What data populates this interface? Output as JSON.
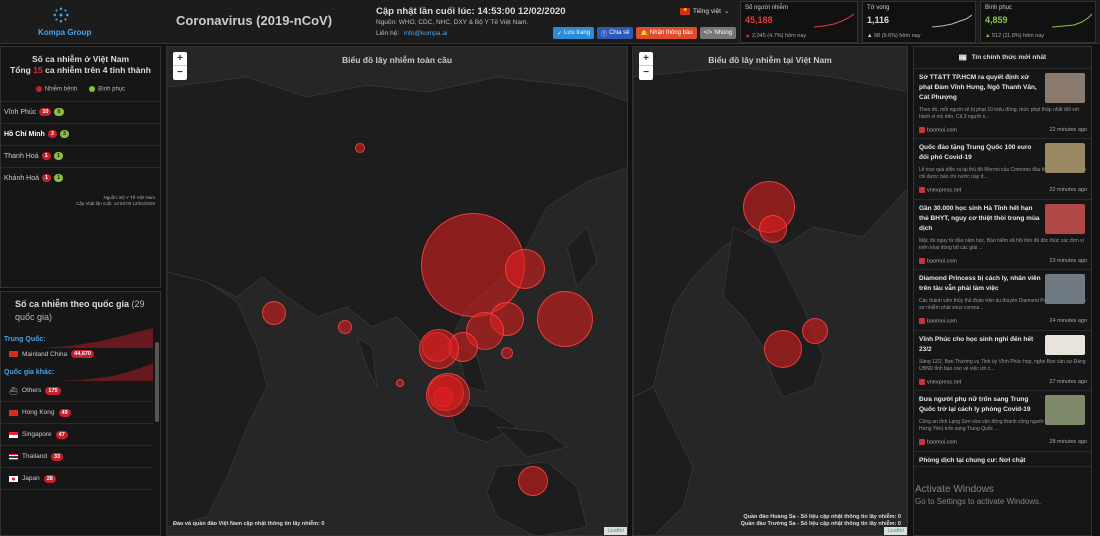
{
  "header": {
    "logo_text": "Kompa Group",
    "title": "Coronavirus (2019-nCoV)",
    "updated": "Cập nhật lần cuối lúc: 14:53:00 12/02/2020",
    "sources": "Nguồn: WHO, CDC, NHC, DXY & Bộ Y Tế Việt Nam.",
    "contact_label": "Liên hệ:",
    "contact_email": "info@kompa.ai",
    "language": "Tiếng việt",
    "buttons": {
      "save": "Lưu trang",
      "share": "Chia sẻ",
      "notify": "Nhận thông báo",
      "embed": "Nhúng"
    }
  },
  "stats": [
    {
      "label": "Số người nhiễm",
      "value": "45,188",
      "sub": "2,045 (4.7%) hôm nay",
      "color": "#e23b3b",
      "arrow": "▲"
    },
    {
      "label": "Tử vong",
      "value": "1,116",
      "sub": "98 (9.6%) hôm nay",
      "color": "#dddddd",
      "arrow": "▲"
    },
    {
      "label": "Bình phục",
      "value": "4,859",
      "sub": "512 (11.8%) hôm nay",
      "color": "#8bc34a",
      "arrow": "▲"
    }
  ],
  "vietnam": {
    "title_line1": "Số ca nhiễm ở Việt Nam",
    "total_prefix": "Tổng",
    "total": "15",
    "total_suffix": "ca nhiễm trên 4 tỉnh thành",
    "legend_infected": "Nhiễm bệnh",
    "legend_recovered": "Bình phục",
    "provinces": [
      {
        "name": "Vĩnh Phúc",
        "infected": "10",
        "recovered": "6",
        "bold": false
      },
      {
        "name": "Hồ Chí Minh",
        "infected": "3",
        "recovered": "3",
        "bold": true
      },
      {
        "name": "Thanh Hoá",
        "infected": "1",
        "recovered": "1",
        "bold": false
      },
      {
        "name": "Khánh Hoà",
        "infected": "1",
        "recovered": "1",
        "bold": false
      }
    ],
    "source_line1": "Nguồn: Bộ Y Tế Việt Nam",
    "source_line2": "Cập nhật lần cuối: 14:53:00 12/02/2020"
  },
  "countries": {
    "title": "Số ca nhiễm theo quốc gia",
    "count": "(29",
    "title_line2": "quốc gia)",
    "china_label": "Trung Quốc:",
    "china": {
      "name": "Mainland China",
      "value": "44,670"
    },
    "other_label": "Quốc gia khác:",
    "list": [
      {
        "name": "Others",
        "value": "175",
        "flag": "others"
      },
      {
        "name": "Hong Kong",
        "value": "49",
        "flag": "hk"
      },
      {
        "name": "Singapore",
        "value": "47",
        "flag": "sg"
      },
      {
        "name": "Thailand",
        "value": "33",
        "flag": "th"
      },
      {
        "name": "Japan",
        "value": "28",
        "flag": "jp"
      }
    ]
  },
  "maps": {
    "global_title": "Biểu đồ lây nhiễm toàn cầu",
    "global_foot": "Đảo và quần đảo Việt Nam cập nhật thông tin lây nhiễm: 0",
    "vn_title": "Biểu đồ lây nhiễm tại Việt Nam",
    "vn_foot1": "Quần đảo Hoàng Sa - Số liệu cập nhật thông tin lây nhiễm: 0",
    "vn_foot2": "Quần đảo Trường Sa - Số liệu cập nhật thông tin lây nhiễm: 0",
    "attribution": "Leaflet",
    "zoom_in": "+",
    "zoom_out": "−"
  },
  "news": {
    "heading": "Tin chính thức mới nhất",
    "items": [
      {
        "title": "Sở TT&TT TP.HCM ra quyết định xử phạt Đàm Vĩnh Hưng, Ngô Thanh Vân, Cát Phượng",
        "desc": "Theo đó, mỗi người sẽ bị phạt 10 triệu đồng, mức phạt thấp nhất đối với hành vi nói trên. Cả 3 người s...",
        "source": "baomoi.com",
        "time": "22 minutes ago",
        "thumb": "#8a7b6e"
      },
      {
        "title": "Quốc đảo tặng Trung Quốc 100 euro đối phó Covid-19",
        "desc": "Lễ trao quà diễn ra tại thủ đô Moroni của Comoros đầu tháng 1, nhưng mới chỉ được báo chí nước này đ...",
        "source": "vnexpress.net",
        "time": "22 minutes ago",
        "thumb": "#9a8a63"
      },
      {
        "title": "Gần 30.000 học sinh Hà Tĩnh hết hạn thẻ BHYT, nguy cơ thiệt thòi trong mùa dịch",
        "desc": "Mặc dù nguy từ đầu năm học, Bảo hiểm xã hội tỉnh đã đôc thúc các đơn vị triển khai đóng bổ các giải ...",
        "source": "baomoi.com",
        "time": "23 minutes ago",
        "thumb": "#b04848"
      },
      {
        "title": "Diamond Princess bị cách ly, nhân viên trên tàu vẫn phải làm việc",
        "desc": "Các thành viên thủy thủ đoàn trên du thuyền Diamond Princess nói rằng họ sợ nhiễm phải virus corona ...",
        "source": "baomoi.com",
        "time": "24 minutes ago",
        "thumb": "#6f7a83"
      },
      {
        "title": "Vĩnh Phúc cho học sinh nghỉ đến hết 23/2",
        "desc": "Sáng 12/2, Ban Thường vụ Tỉnh ủy Vĩnh Phúc họp, nghe Ban cán sự Đảng UBND tỉnh báo cáo về việc ứn c...",
        "source": "vnexpress.net",
        "time": "27 minutes ago",
        "thumb": "#e8e4dc"
      },
      {
        "title": "Đưa người phụ nữ trốn sang Trung Quốc trở lại cách ly phòng Covid-19",
        "desc": "Công an tỉnh Lạng Sơn vừa vận động thành công người phụ nữ (quê ở Hưng Yên) trốn sang Trung Quốc ...",
        "source": "baomoi.com",
        "time": "28 minutes ago",
        "thumb": "#7f8a6a"
      },
      {
        "title": "Phòng dịch tại chung cư: Nơi chặt",
        "desc": "",
        "source": "",
        "time": "",
        "thumb": "#555"
      }
    ]
  },
  "watermark": {
    "line1": "Activate Windows",
    "line2": "Go to Settings to activate Windows."
  }
}
